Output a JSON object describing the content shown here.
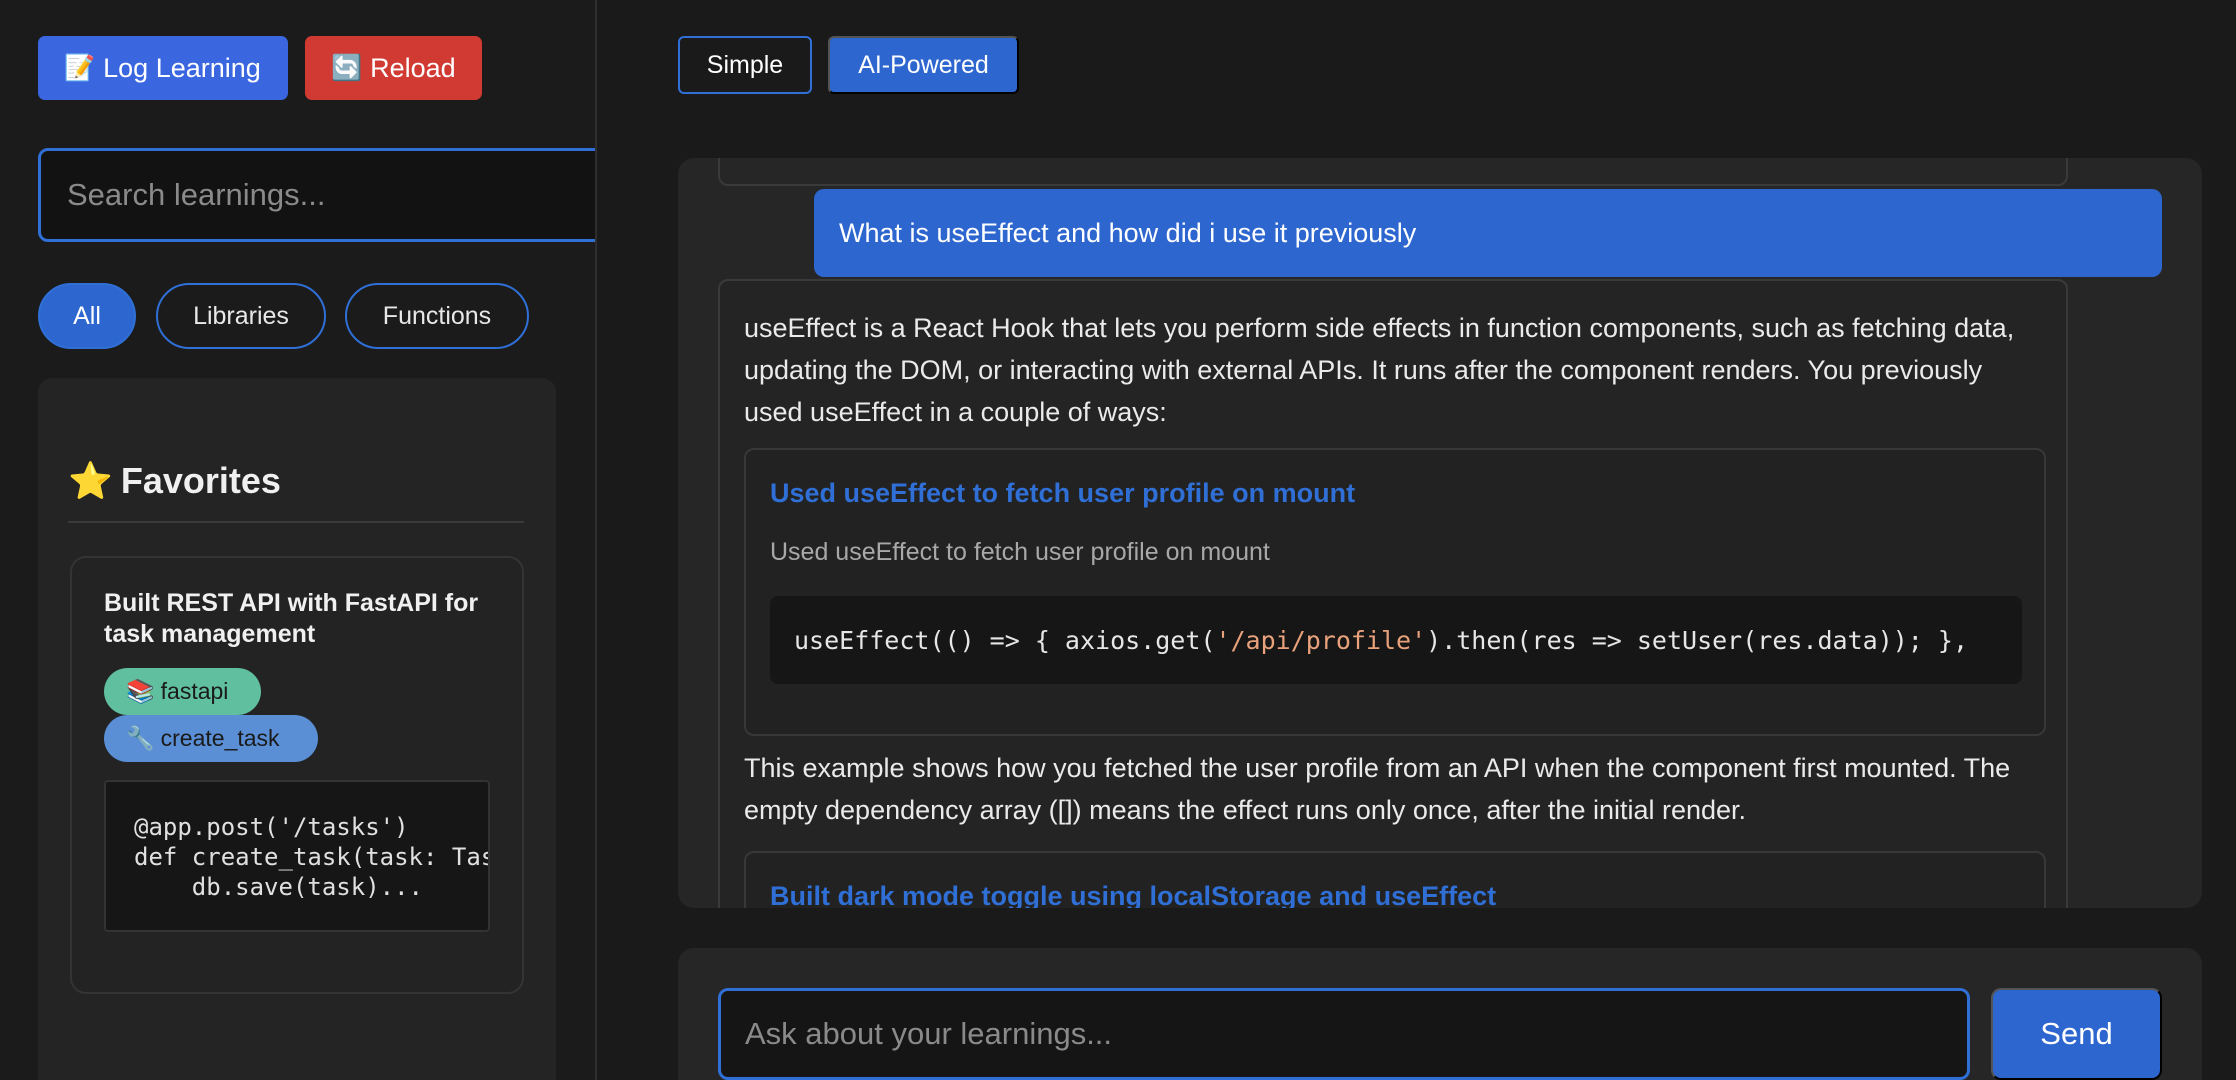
{
  "sidebar": {
    "log_button": {
      "icon": "📝",
      "label": "Log Learning"
    },
    "reload_button": {
      "icon": "🔄",
      "label": "Reload"
    },
    "search_placeholder": "Search learnings...",
    "filters": [
      {
        "label": "All",
        "active": true
      },
      {
        "label": "Libraries",
        "active": false
      },
      {
        "label": "Functions",
        "active": false
      }
    ],
    "favorites": {
      "icon": "⭐",
      "title": "Favorites",
      "card": {
        "title": "Built REST API with FastAPI for task management",
        "tags": [
          {
            "icon": "📚",
            "label": "fastapi",
            "color": "#5fbf9e"
          },
          {
            "icon": "🔧",
            "label": "create_task",
            "color": "#5a8fd6"
          }
        ],
        "code": "@app.post('/tasks')\ndef create_task(task: Task):\n    db.save(task)..."
      }
    }
  },
  "main": {
    "modes": [
      {
        "label": "Simple",
        "active": false
      },
      {
        "label": "AI-Powered",
        "active": true
      }
    ],
    "chat": {
      "user_message": "What is useEffect and how did i use it previously",
      "ai_intro": "useEffect is a React Hook that lets you perform side effects in function components, such as fetching data, updating the DOM, or interacting with external APIs. It runs after the component renders. You previously used useEffect in a couple of ways:",
      "references": [
        {
          "title": "Used useEffect to fetch user profile on mount",
          "subtitle": "Used useEffect to fetch user profile on mount",
          "code_before": "useEffect(() => { axios.get(",
          "code_string": "'/api/profile'",
          "code_after": ").then(res => setUser(res.data)); },"
        },
        {
          "title": "Built dark mode toggle using localStorage and useEffect"
        }
      ],
      "ai_followup": "This example shows how you fetched the user profile from an API when the component first mounted. The empty dependency array ([]) means the effect runs only once, after the initial render."
    },
    "composer": {
      "placeholder": "Ask about your learnings...",
      "send_label": "Send"
    }
  },
  "colors": {
    "accent": "#2d66cf",
    "danger": "#d13a33",
    "background": "#1a1a1a"
  }
}
